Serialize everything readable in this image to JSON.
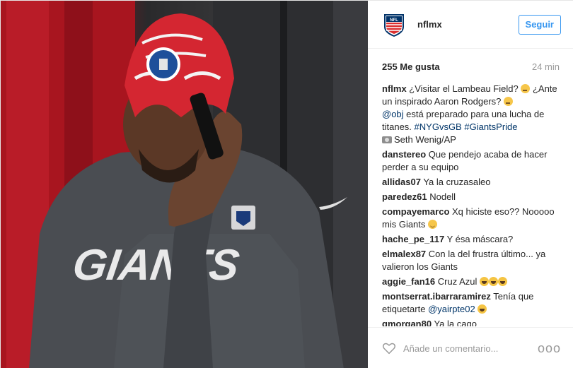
{
  "post": {
    "username": "nflmx",
    "follow_label": "Seguir",
    "likes": "255 Me gusta",
    "time": "24 min",
    "add_comment_placeholder": "Añade un comentario...",
    "more_label": "ooo"
  },
  "caption": {
    "user": "nflmx",
    "text_1": "¿Visitar el Lambeau Field?",
    "text_2": "¿Ante un inspirado Aaron Rodgers?",
    "mention": "@obj",
    "text_3": "está preparado para una lucha de titanes.",
    "hashtag_1": "#NYGvsGB",
    "hashtag_2": "#GiantsPride",
    "credit": "Seth Wenig/AP"
  },
  "comments": [
    {
      "user": "danstereo",
      "text": "Que pendejo acaba de hacer perder a su equipo"
    },
    {
      "user": "allidas07",
      "text": "Ya la cruzasaleo"
    },
    {
      "user": "paredez61",
      "text": "Nodell"
    },
    {
      "user": "compayemarco",
      "text": "Xq hiciste eso?? Nooooo mis Giants"
    },
    {
      "user": "hache_pe_117",
      "text": "Y ésa máscara?"
    },
    {
      "user": "elmalex87",
      "text": "Con la del frustra último... ya valieron los Giants"
    },
    {
      "user": "aggie_fan16",
      "text": "Cruz Azul"
    },
    {
      "user": "montserrat.ibarraramirez",
      "text": "Tenía que etiquetarte",
      "mention": "@yairpte02"
    },
    {
      "user": "gmorgan80",
      "text": "Ya la cago"
    }
  ],
  "photo": {
    "shirt_text": "GIANTS",
    "colors": {
      "mask_red": "#d42631",
      "shirt": "#4a4d52",
      "locker_red": "#b01a24"
    }
  },
  "icons": {
    "avatar": "nfl-shield-logo",
    "heart": "heart-outline-icon",
    "camera": "camera-emoji-icon",
    "more": "ellipsis-icon"
  },
  "colors": {
    "accent": "#3897f0",
    "link": "#003569",
    "muted": "#999999"
  }
}
